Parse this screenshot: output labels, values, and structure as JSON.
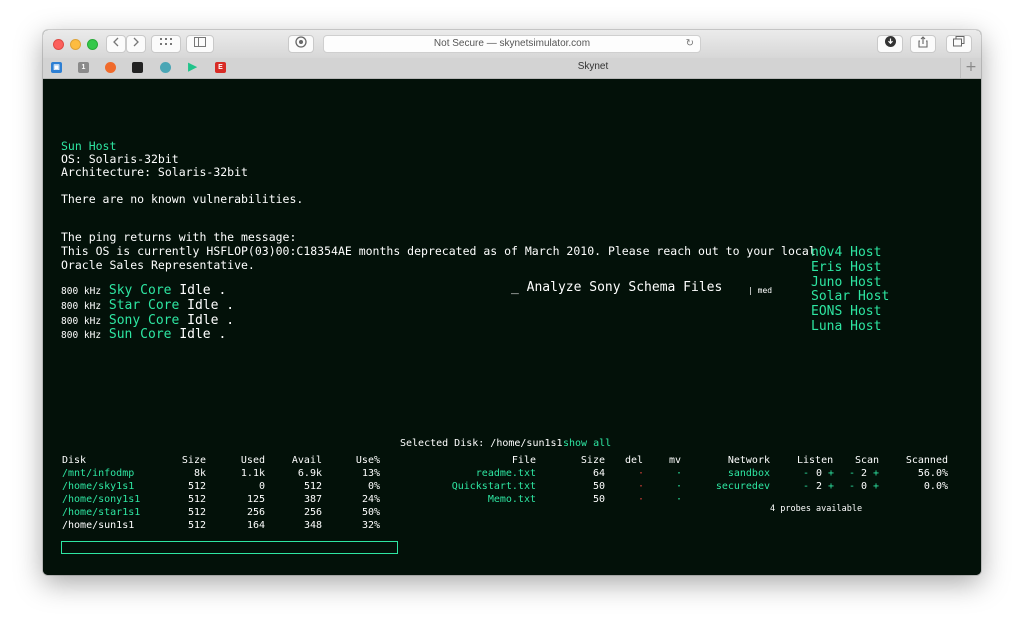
{
  "browser": {
    "url_text": "Not Secure — skynetsimulator.com",
    "tab_title": "Skynet",
    "new_tab": "+",
    "reload_icon": "reload-icon"
  },
  "host": {
    "name": "Sun Host",
    "os": "OS: Solaris-32bit",
    "arch": "Architecture: Solaris-32bit",
    "vuln": "There are no known vulnerabilities.",
    "ping_line1": "The ping returns with the message:",
    "ping_line2": "This OS is currently HSFLOP(03)00:C18354AE months deprecated as of March 2010. Please reach out to your local",
    "ping_line3": "Oracle Sales Representative."
  },
  "cores": [
    {
      "freq": "800 kHz",
      "name": "Sky Core",
      "status": "Idle ."
    },
    {
      "freq": "800 kHz",
      "name": "Star Core",
      "status": "Idle ."
    },
    {
      "freq": "800 kHz",
      "name": "Sony Core",
      "status": "Idle ."
    },
    {
      "freq": "800 kHz",
      "name": "Sun Core",
      "status": "Idle ."
    }
  ],
  "task": {
    "label": "_ Analyze Sony Schema Files",
    "level": "| med"
  },
  "hosts": [
    "n0v4 Host",
    "Eris Host",
    "Juno Host",
    "Solar Host",
    "EONS Host",
    "Luna Host"
  ],
  "disks": {
    "headers": [
      "Disk",
      "Size",
      "Used",
      "Avail",
      "Use%"
    ],
    "rows": [
      [
        "/mnt/infodmp",
        "8k",
        "1.1k",
        "6.9k",
        "13%"
      ],
      [
        "/home/sky1s1",
        "512",
        "0",
        "512",
        "0%"
      ],
      [
        "/home/sony1s1",
        "512",
        "125",
        "387",
        "24%"
      ],
      [
        "/home/star1s1",
        "512",
        "256",
        "256",
        "50%"
      ],
      [
        "/home/sun1s1",
        "512",
        "164",
        "348",
        "32%"
      ]
    ]
  },
  "files": {
    "selected_label": "Selected Disk: /home/sun1s1",
    "show_all": "show all",
    "headers": [
      "File",
      "Size",
      "del",
      "mv"
    ],
    "rows": [
      {
        "name": "readme.txt",
        "size": "64",
        "del": "·",
        "mv": "·"
      },
      {
        "name": "Quickstart.txt",
        "size": "50",
        "del": "·",
        "mv": "·"
      },
      {
        "name": "Memo.txt",
        "size": "50",
        "del": "·",
        "mv": "·"
      }
    ]
  },
  "network": {
    "headers": [
      "Network",
      "Listen",
      "Scan",
      "Scanned"
    ],
    "rows": [
      {
        "name": "sandbox",
        "listen_minus": "-",
        "listen": "0",
        "listen_plus": "+",
        "scan_minus": "-",
        "scan": "2",
        "scan_plus": "+",
        "scanned": "56.0%"
      },
      {
        "name": "securedev",
        "listen_minus": "-",
        "listen": "2",
        "listen_plus": "+",
        "scan_minus": "-",
        "scan": "0",
        "scan_plus": "+",
        "scanned": "0.0%"
      }
    ],
    "probes": "4 probes available"
  },
  "colors": {
    "accent": "#2ee6a2",
    "background": "#031109",
    "danger": "#e0443c"
  }
}
